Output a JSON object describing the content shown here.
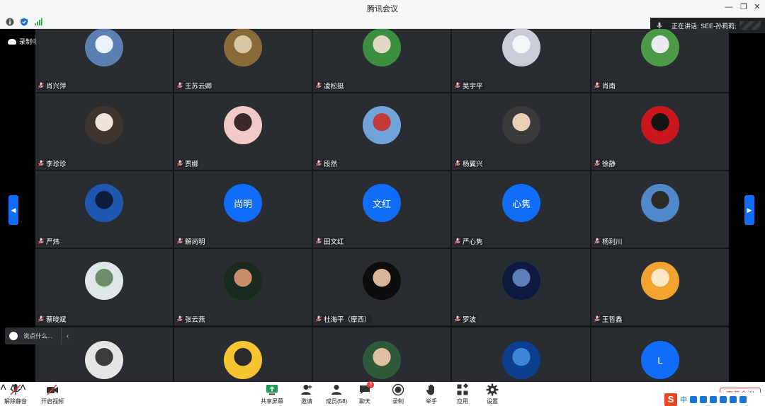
{
  "window": {
    "title": "腾讯会议"
  },
  "recording": {
    "label": "录制中"
  },
  "speaking": {
    "label": "正在讲话: SEE-孙莉莉;"
  },
  "chat": {
    "placeholder": "说点什么..."
  },
  "participants": [
    {
      "name": "肖兴萍",
      "avatar": "photo",
      "colors": [
        "#5a7fb0",
        "#e9f2fb"
      ]
    },
    {
      "name": "王苏云卿",
      "avatar": "photo",
      "colors": [
        "#8b6a3a",
        "#d7c8a3"
      ]
    },
    {
      "name": "凌松挺",
      "avatar": "photo",
      "colors": [
        "#3b8d3f",
        "#e2d6c4"
      ]
    },
    {
      "name": "吴宇平",
      "avatar": "photo",
      "colors": [
        "#c9ced6",
        "#f2f4f6"
      ]
    },
    {
      "name": "肖南",
      "avatar": "photo",
      "colors": [
        "#4c9a48",
        "#e8ecef"
      ]
    },
    {
      "name": "李珍珍",
      "avatar": "photo",
      "colors": [
        "#3e342e",
        "#efe3da"
      ]
    },
    {
      "name": "贾娜",
      "avatar": "photo",
      "colors": [
        "#f2c8c8",
        "#3a2a2a"
      ]
    },
    {
      "name": "段然",
      "avatar": "photo",
      "colors": [
        "#6fa3d9",
        "#c23b3b"
      ]
    },
    {
      "name": "杨翼兴",
      "avatar": "photo",
      "colors": [
        "#3a3a3a",
        "#e8cfb5"
      ]
    },
    {
      "name": "徐静",
      "avatar": "photo",
      "colors": [
        "#c9171c",
        "#141414"
      ]
    },
    {
      "name": "严炜",
      "avatar": "photo",
      "colors": [
        "#1f56b0",
        "#0c1c3a"
      ]
    },
    {
      "name": "解尚明",
      "avatar": "letter",
      "letter": "尚明"
    },
    {
      "name": "田文红",
      "avatar": "letter",
      "letter": "文红"
    },
    {
      "name": "严心隽",
      "avatar": "letter",
      "letter": "心隽"
    },
    {
      "name": "杨利川",
      "avatar": "photo",
      "colors": [
        "#4f89c9",
        "#2c2a26"
      ]
    },
    {
      "name": "蔡晓斌",
      "avatar": "photo",
      "colors": [
        "#dfe6ea",
        "#6d8e6a"
      ]
    },
    {
      "name": "张云燕",
      "avatar": "photo",
      "colors": [
        "#1b2a1f",
        "#c98e6e"
      ]
    },
    {
      "name": "杜海平（摩西）",
      "avatar": "photo",
      "colors": [
        "#0d0d0d",
        "#d9b598"
      ]
    },
    {
      "name": "罗波",
      "avatar": "photo",
      "colors": [
        "#0e1a40",
        "#5d7fb8"
      ]
    },
    {
      "name": "王哲鑫",
      "avatar": "photo",
      "colors": [
        "#f3a430",
        "#fbe8c8"
      ]
    },
    {
      "name": "",
      "avatar": "photo",
      "colors": [
        "#e5e5e5",
        "#3b3b3b"
      ]
    },
    {
      "name": "",
      "avatar": "photo",
      "colors": [
        "#f4c531",
        "#2a2a2a"
      ]
    },
    {
      "name": "",
      "avatar": "photo",
      "colors": [
        "#2e5a3a",
        "#e0c0a0"
      ]
    },
    {
      "name": "",
      "avatar": "photo",
      "colors": [
        "#0b3f8e",
        "#3f86d8"
      ]
    },
    {
      "name": "",
      "avatar": "letter",
      "letter": "L"
    }
  ],
  "toolbar": {
    "unmute": "解除静音",
    "video": "开启视频",
    "share": "共享屏幕",
    "invite": "邀请",
    "members": "成员(58)",
    "chat": "聊天",
    "chat_badge": "3",
    "record": "录制",
    "raise_hand": "举手",
    "apps": "应用",
    "settings": "设置",
    "end": "离开会议"
  },
  "ime": {
    "lang": "中"
  }
}
